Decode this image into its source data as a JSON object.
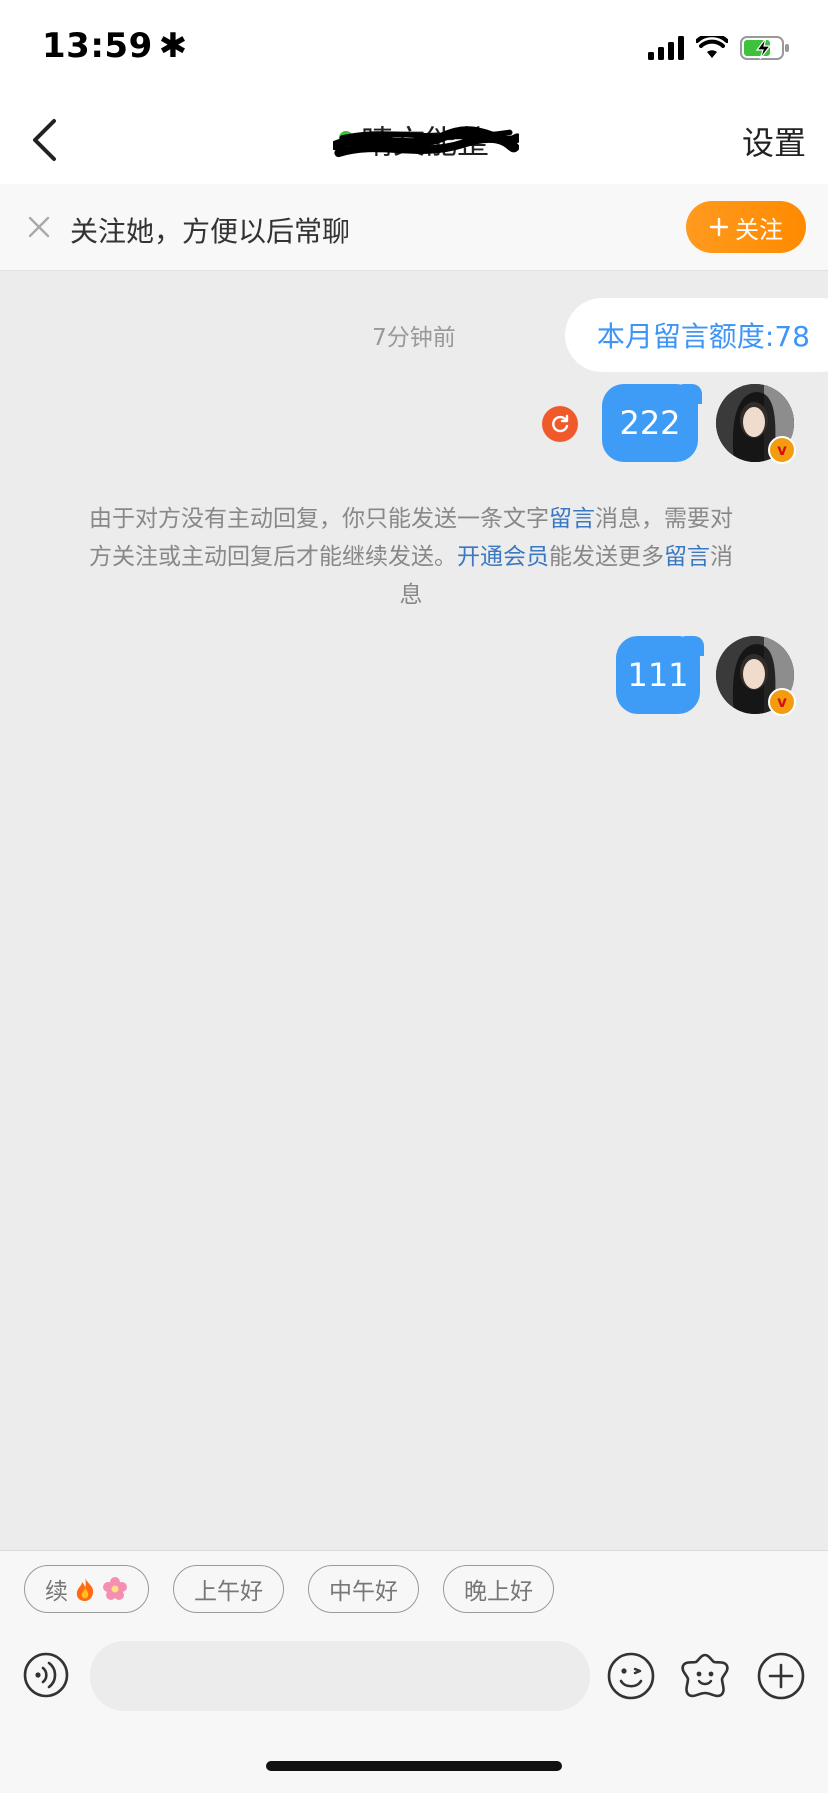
{
  "status_bar": {
    "time": "13:59",
    "time_suffix": "✱"
  },
  "navbar": {
    "title": "晴文能整",
    "settings_label": "设置"
  },
  "follow_banner": {
    "text": "关注她，方便以后常聊",
    "button_label": "关注"
  },
  "chat": {
    "timestamp": "7分钟前",
    "quota_text": "本月留言额度:78",
    "messages": [
      {
        "text": "222",
        "status": "failed"
      },
      {
        "text": "111"
      }
    ],
    "notice": {
      "part1": "由于对方没有主动回复，你只能发送一条文字",
      "link1": "留言",
      "part2": "消息，需要对方关注或主动回复后才能继续发送。",
      "link2": "开通会员",
      "part3": "能发送更多",
      "link3": "留言",
      "part4": "消息"
    }
  },
  "quick_replies": [
    {
      "label": "续",
      "emojis": [
        "fire",
        "flower"
      ]
    },
    {
      "label": "上午好"
    },
    {
      "label": "中午好"
    },
    {
      "label": "晚上好"
    }
  ],
  "input": {
    "placeholder": ""
  },
  "colors": {
    "accent_blue": "#3e9bf6",
    "follow_orange": "#ff8a00",
    "link_blue": "#3b78c2",
    "resend_red": "#f05a2a"
  }
}
